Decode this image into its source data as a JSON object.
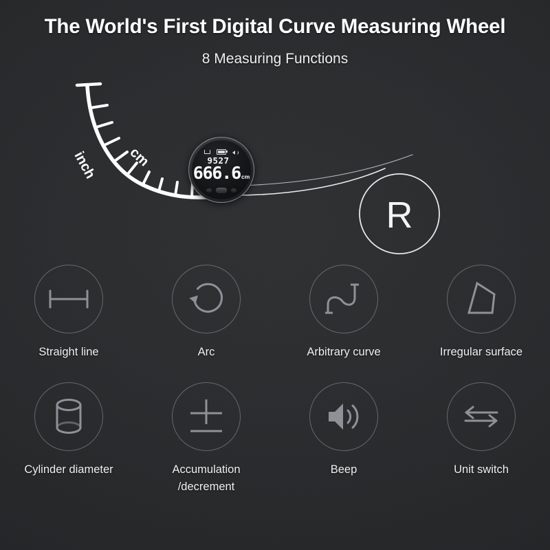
{
  "headline": "The World's First Digital Curve Measuring Wheel",
  "subhead": "8 Measuring Functions",
  "hero": {
    "ruler": {
      "unit_inch": "inch",
      "unit_cm": "cm"
    },
    "radius_marker": {
      "label": "R",
      "name": "radius-circle"
    },
    "device": {
      "display": {
        "secondary_value": "9527",
        "main_value": "666.6",
        "unit": "cm",
        "status_icons": [
          "bracket-icon",
          "battery-icon",
          "speaker-icon"
        ],
        "battery_bars": 3
      },
      "buttons": [
        "left-button",
        "center-button",
        "right-button"
      ]
    }
  },
  "functions": {
    "rows": [
      [
        {
          "label": "Straight line",
          "icon": "straight-line-icon"
        },
        {
          "label": "Arc",
          "icon": "arc-icon"
        },
        {
          "label": "Arbitrary curve",
          "icon": "arbitrary-curve-icon"
        },
        {
          "label": "Irregular surface",
          "icon": "irregular-surface-icon"
        }
      ],
      [
        {
          "label": "Cylinder diameter",
          "icon": "cylinder-icon"
        },
        {
          "label": "Accumulation\n/decrement",
          "icon": "plus-minus-icon"
        },
        {
          "label": "Beep",
          "icon": "speaker-icon"
        },
        {
          "label": "Unit switch",
          "icon": "swap-arrows-icon"
        }
      ]
    ]
  },
  "colors": {
    "background": "#27292b",
    "text": "#f2f2f2",
    "icon_stroke": "#8e9297",
    "circle_outline": "#bec2c8",
    "ruler_white": "#ffffff"
  }
}
